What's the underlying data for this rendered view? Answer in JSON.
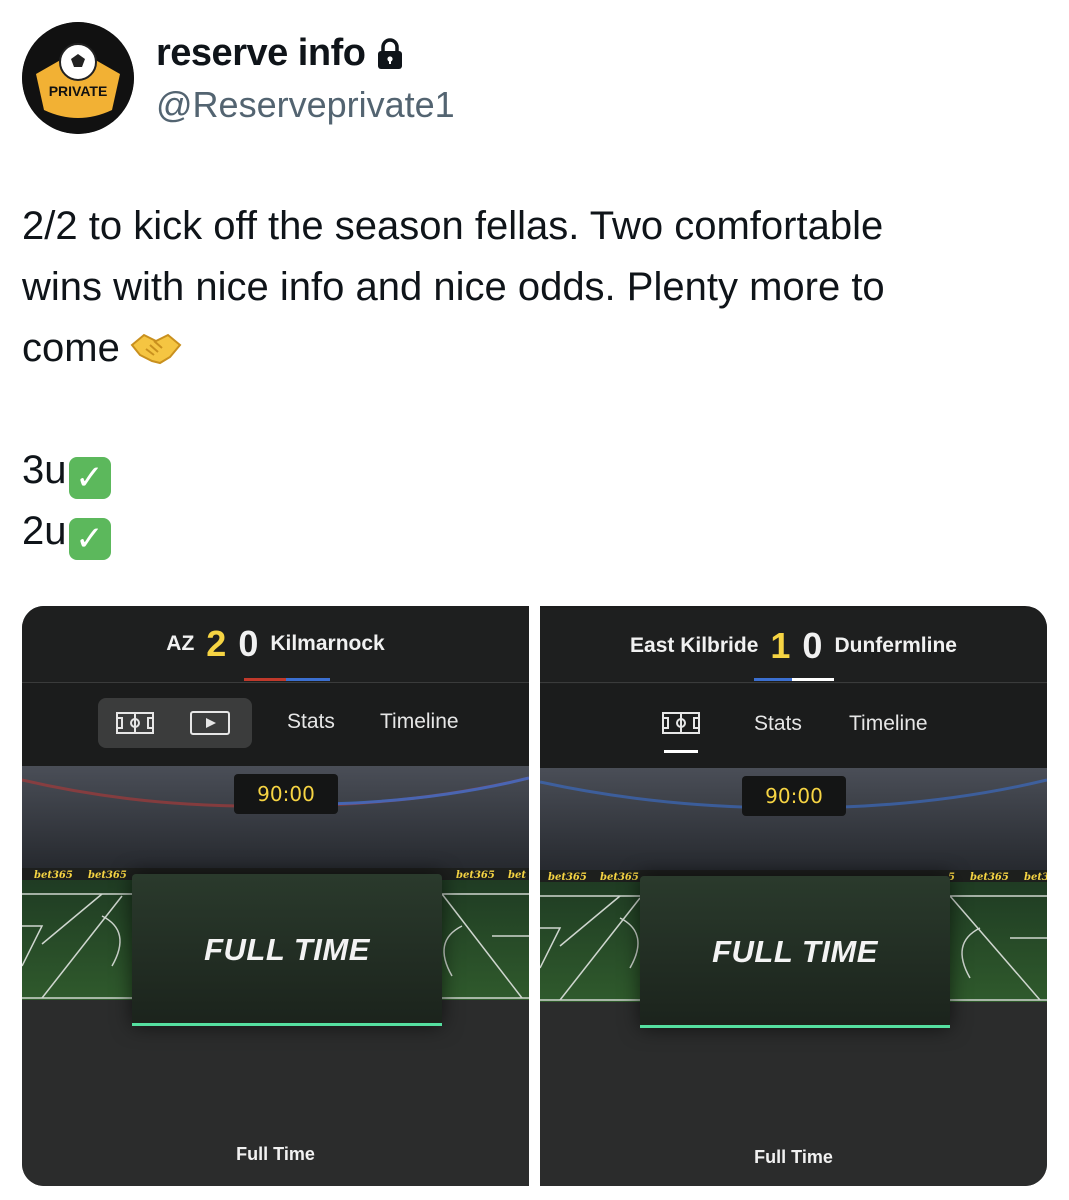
{
  "user": {
    "display_name": "reserve info",
    "handle": "@Reserveprivate1",
    "avatar_label": "PRIVATE"
  },
  "tweet": {
    "line1": "2/2 to kick off the season fellas. Two comfortable",
    "line2": "wins with nice info and nice odds. Plenty more to",
    "line3": "come",
    "units": [
      "3u",
      "2u"
    ]
  },
  "matches": [
    {
      "home": "AZ",
      "home_score": "2",
      "away_score": "0",
      "away": "Kilmarnock",
      "clock": "90:00",
      "board": "FULL TIME",
      "status": "Full Time",
      "tabs": [
        "Stats",
        "Timeline"
      ],
      "ads": [
        "bet365",
        "bet365",
        "bet365",
        "bet"
      ]
    },
    {
      "home": "East Kilbride",
      "home_score": "1",
      "away_score": "0",
      "away": "Dunfermline",
      "clock": "90:00",
      "board": "FULL TIME",
      "status": "Full Time",
      "tabs": [
        "Stats",
        "Timeline"
      ],
      "ads": [
        "bet365",
        "bet365",
        "5",
        "bet365",
        "bet3"
      ]
    }
  ],
  "colors": {
    "score_yellow": "#f6d443",
    "check_green": "#5cb85c",
    "fulltime_line": "#55e0a0",
    "home_red": "#c0392b",
    "away_blue": "#3b6fd0"
  },
  "icons": [
    "lock-icon",
    "handshake-icon",
    "check-mark-icon",
    "pitch-icon",
    "play-icon"
  ]
}
